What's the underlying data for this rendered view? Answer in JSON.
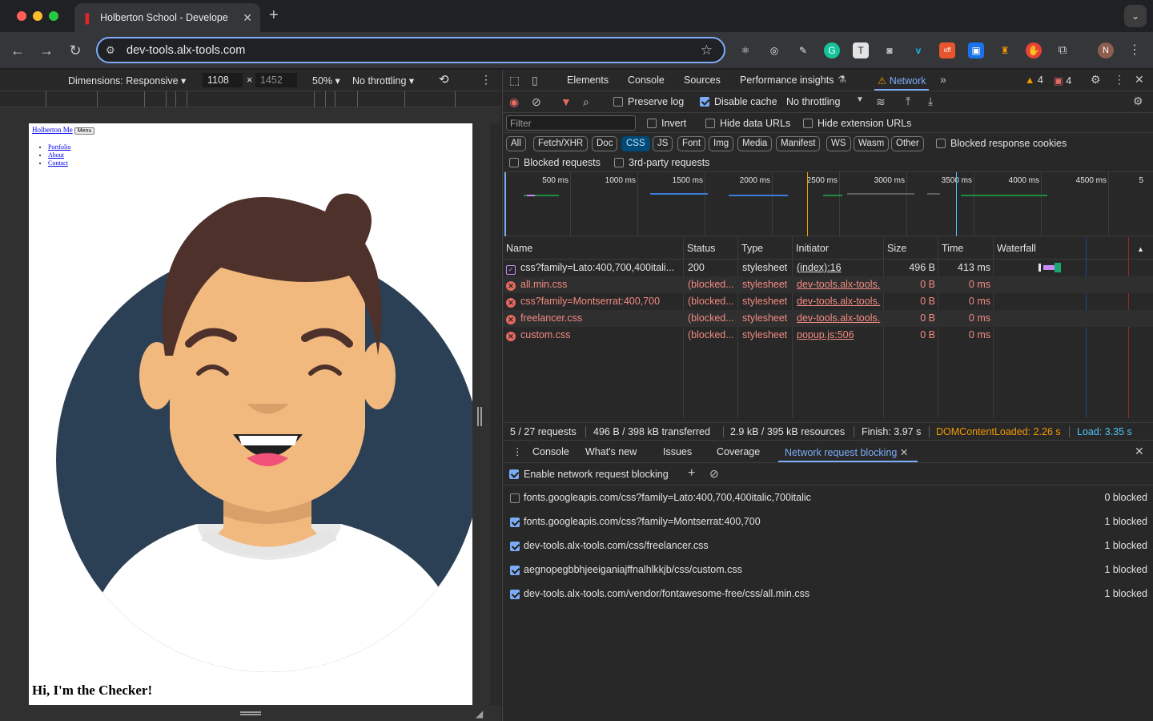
{
  "browser": {
    "tab_title": "Holberton School - Develope",
    "url": "dev-tools.alx-tools.com",
    "profile_initial": "N"
  },
  "device_toolbar": {
    "dimensions": "Dimensions: Responsive ▾",
    "width": "1108",
    "x": "×",
    "height": "1452",
    "zoom": "50% ▾",
    "throttling": "No throttling ▾"
  },
  "page": {
    "nav_link": "Holberton Me",
    "menu_button": "Menu",
    "links": [
      "Portfolio",
      "About",
      "Contact"
    ],
    "heading": "Hi, I'm the Checker!"
  },
  "devtools": {
    "tabs": [
      "Elements",
      "Console",
      "Sources",
      "Performance insights",
      "Network"
    ],
    "warnings": "4",
    "errors": "4",
    "toolbar": {
      "preserve_log": "Preserve log",
      "disable_cache": "Disable cache",
      "throttling": "No throttling"
    },
    "filter": {
      "placeholder": "Filter",
      "invert": "Invert",
      "hide_data_urls": "Hide data URLs",
      "hide_extension_urls": "Hide extension URLs"
    },
    "types": [
      "All",
      "Fetch/XHR",
      "Doc",
      "CSS",
      "JS",
      "Font",
      "Img",
      "Media",
      "Manifest",
      "WS",
      "Wasm",
      "Other"
    ],
    "active_type": "CSS",
    "blocked_response_cookies": "Blocked response cookies",
    "blocked_requests": "Blocked requests",
    "third_party": "3rd-party requests",
    "overview_ticks": [
      "500 ms",
      "1000 ms",
      "1500 ms",
      "2000 ms",
      "2500 ms",
      "3000 ms",
      "3500 ms",
      "4000 ms",
      "4500 ms",
      "5"
    ],
    "columns": [
      "Name",
      "Status",
      "Type",
      "Initiator",
      "Size",
      "Time",
      "Waterfall"
    ],
    "rows": [
      {
        "name": "css?family=Lato:400,700,400itali...",
        "status": "200",
        "type": "stylesheet",
        "initiator": "(index):16",
        "size": "496 B",
        "time": "413 ms",
        "error": false
      },
      {
        "name": "all.min.css",
        "status": "(blocked...",
        "type": "stylesheet",
        "initiator": "dev-tools.alx-tools.",
        "size": "0 B",
        "time": "0 ms",
        "error": true
      },
      {
        "name": "css?family=Montserrat:400,700",
        "status": "(blocked...",
        "type": "stylesheet",
        "initiator": "dev-tools.alx-tools.",
        "size": "0 B",
        "time": "0 ms",
        "error": true
      },
      {
        "name": "freelancer.css",
        "status": "(blocked...",
        "type": "stylesheet",
        "initiator": "dev-tools.alx-tools.",
        "size": "0 B",
        "time": "0 ms",
        "error": true
      },
      {
        "name": "custom.css",
        "status": "(blocked...",
        "type": "stylesheet",
        "initiator": "popup.js:506",
        "size": "0 B",
        "time": "0 ms",
        "error": true
      }
    ],
    "summary": {
      "requests": "5 / 27 requests",
      "transferred": "496 B / 398 kB transferred",
      "resources": "2.9 kB / 395 kB resources",
      "finish": "Finish: 3.97 s",
      "dcl": "DOMContentLoaded: 2.26 s",
      "load": "Load: 3.35 s"
    },
    "drawer_tabs": [
      "Console",
      "What's new",
      "Issues",
      "Coverage",
      "Network request blocking"
    ],
    "enable_blocking": "Enable network request blocking",
    "patterns": [
      {
        "pattern": "fonts.googleapis.com/css?family=Lato:400,700,400italic,700italic",
        "count": "0 blocked",
        "checked": false
      },
      {
        "pattern": "fonts.googleapis.com/css?family=Montserrat:400,700",
        "count": "1 blocked",
        "checked": true
      },
      {
        "pattern": "dev-tools.alx-tools.com/css/freelancer.css",
        "count": "1 blocked",
        "checked": true
      },
      {
        "pattern": "aegnopegbbhjeeiganiajffnalhlkkjb/css/custom.css",
        "count": "1 blocked",
        "checked": true
      },
      {
        "pattern": "dev-tools.alx-tools.com/vendor/fontawesome-free/css/all.min.css",
        "count": "1 blocked",
        "checked": true
      }
    ]
  },
  "colors": {
    "accent": "#7cacf8",
    "error": "#f28b82",
    "dcl": "#f29900",
    "load": "#4fc3f7",
    "avatar_bg": "#2b3f55",
    "skin": "#f2b97e",
    "hair": "#4e312b"
  }
}
